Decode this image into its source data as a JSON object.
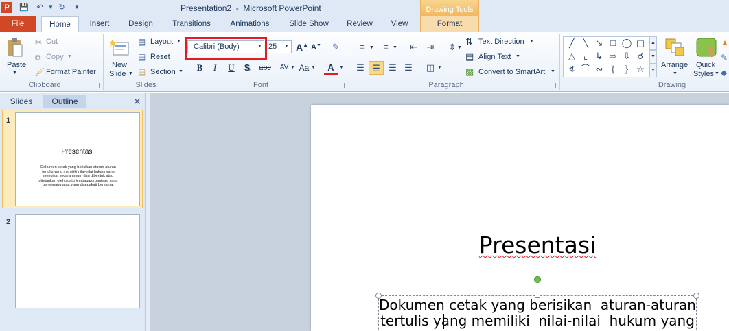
{
  "title_bar": {
    "title": "Presentation2  -  Microsoft PowerPoint",
    "contextual_group": "Drawing Tools"
  },
  "tabs": {
    "file": "File",
    "home": "Home",
    "insert": "Insert",
    "design": "Design",
    "transitions": "Transitions",
    "animations": "Animations",
    "slide_show": "Slide Show",
    "review": "Review",
    "view": "View",
    "format": "Format"
  },
  "clipboard": {
    "paste": "Paste",
    "cut": "Cut",
    "copy": "Copy",
    "format_painter": "Format Painter",
    "group": "Clipboard"
  },
  "slides_group": {
    "new_slide_line1": "New",
    "new_slide_line2": "Slide",
    "layout": "Layout",
    "reset": "Reset",
    "section": "Section",
    "group": "Slides"
  },
  "font_group": {
    "font_name": "Calibri (Body)",
    "font_size": "25",
    "group": "Font"
  },
  "paragraph_group": {
    "text_direction": "Text Direction",
    "align_text": "Align Text",
    "convert_smartart": "Convert to SmartArt",
    "group": "Paragraph"
  },
  "drawing_group": {
    "arrange": "Arrange",
    "quick_styles_line1": "Quick",
    "quick_styles_line2": "Styles",
    "group": "Drawing"
  },
  "panel": {
    "tab_slides": "Slides",
    "tab_outline": "Outline",
    "slide1_number": "1",
    "slide2_number": "2",
    "slide1_title": "Presentasi",
    "slide1_body": "Dokumen cetak yang berisikan  aturan-aturan tertulis yang memiliki  nilai-nilai  hukum yang mengikat secara umum dan dibentuk atau ditetapkan  oleh suatu  lembaga/organisasi  yang berwenang  atau yang disepakati  bersama."
  },
  "slide": {
    "title": "Presentasi",
    "line1": "Dokumen cetak yang berisikan  aturan-aturan",
    "line2": "tertulis yang memiliki  nilai-nilai  hukum yang"
  }
}
